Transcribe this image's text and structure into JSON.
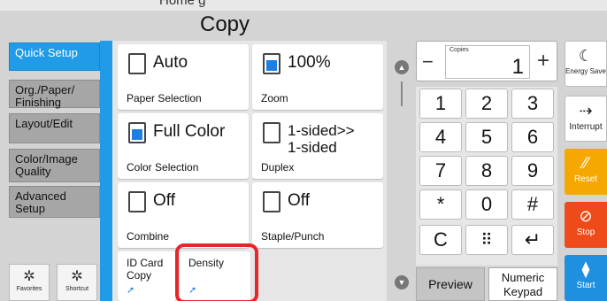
{
  "header": {
    "clipped_text": "Home g",
    "title": "Copy"
  },
  "nav": {
    "items": [
      {
        "label": "Quick Setup"
      },
      {
        "label": "Org./Paper/ Finishing"
      },
      {
        "label": "Layout/Edit"
      },
      {
        "label": "Color/Image Quality"
      },
      {
        "label": "Advanced Setup"
      }
    ],
    "favorites_label": "Favorites",
    "shortcut_label": "Shortcut"
  },
  "tiles": {
    "paper": {
      "value": "Auto",
      "label": "Paper Selection"
    },
    "zoom": {
      "value": "100%",
      "label": "Zoom"
    },
    "color": {
      "value": "Full Color",
      "label": "Color Selection"
    },
    "duplex": {
      "value_line1": "1-sided>>",
      "value_line2": "1-sided",
      "label": "Duplex"
    },
    "combine": {
      "value": "Off",
      "label": "Combine"
    },
    "staple": {
      "value": "Off",
      "label": "Staple/Punch"
    },
    "idcard": {
      "label_line1": "ID Card",
      "label_line2": "Copy"
    },
    "density": {
      "label": "Density"
    }
  },
  "copies": {
    "label": "Copies",
    "value": "1",
    "minus": "−",
    "plus": "+"
  },
  "keypad": {
    "keys": [
      "1",
      "2",
      "3",
      "4",
      "5",
      "6",
      "7",
      "8",
      "9",
      "*",
      "0",
      "#"
    ],
    "clear": "C",
    "dots": "⠿",
    "enter": "↵"
  },
  "preview_label": "Preview",
  "numeric_keypad": {
    "line1": "Numeric",
    "line2": "Keypad"
  },
  "side": {
    "energy": "Energy Saver",
    "interrupt": "Interrupt",
    "reset": "Reset",
    "stop": "Stop",
    "start": "Start"
  },
  "colors": {
    "accent": "#1f9be8",
    "reset": "#f5a800",
    "stop": "#ee4a1a",
    "start": "#1f8fe0",
    "highlight": "#e5262a"
  }
}
